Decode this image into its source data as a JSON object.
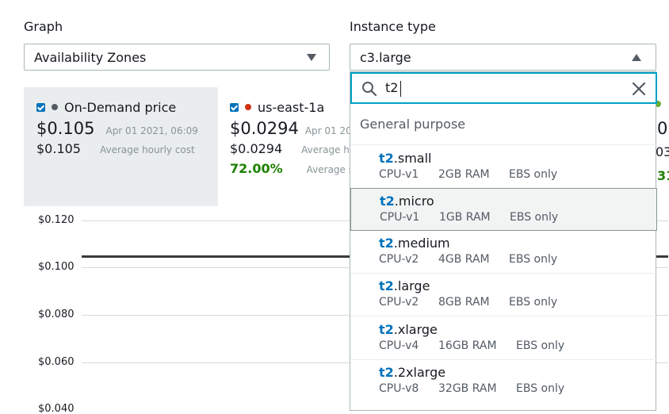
{
  "graph": {
    "label": "Graph",
    "selected": "Availability Zones"
  },
  "instance_type": {
    "label": "Instance type",
    "selected": "c3.large"
  },
  "search": {
    "value": "t2"
  },
  "cards": [
    {
      "name": "On-Demand price",
      "dot_color": "#545b64",
      "price": "$0.105",
      "timestamp": "Apr 01 2021, 06:09",
      "avg_value": "$0.105",
      "avg_label": "Average hourly cost",
      "savings": "",
      "savings_label": ""
    },
    {
      "name": "us-east-1a",
      "dot_color": "#d13212",
      "price": "$0.0294",
      "timestamp": "Apr 01 20",
      "avg_value": "$0.0294",
      "avg_label": "Average ho",
      "savings": "72.00%",
      "savings_label": "Average sa"
    }
  ],
  "card3_partial": {
    "dot_color": "#6aaf35",
    "price": "0",
    "avg": "03",
    "savings": "31"
  },
  "chart": {
    "y_ticks": [
      "$0.120",
      "$0.100",
      "$0.080",
      "$0.060",
      "$0.040"
    ],
    "line_value": "0.105"
  },
  "dropdown": {
    "group": "General purpose",
    "options": [
      {
        "prefix": "t2",
        "suffix": ".small",
        "cpu": "CPU-v1",
        "ram": "2GB RAM",
        "storage": "EBS only",
        "selected": false
      },
      {
        "prefix": "t2",
        "suffix": ".micro",
        "cpu": "CPU-v1",
        "ram": "1GB RAM",
        "storage": "EBS only",
        "selected": true
      },
      {
        "prefix": "t2",
        "suffix": ".medium",
        "cpu": "CPU-v2",
        "ram": "4GB RAM",
        "storage": "EBS only",
        "selected": false
      },
      {
        "prefix": "t2",
        "suffix": ".large",
        "cpu": "CPU-v2",
        "ram": "8GB RAM",
        "storage": "EBS only",
        "selected": false
      },
      {
        "prefix": "t2",
        "suffix": ".xlarge",
        "cpu": "CPU-v4",
        "ram": "16GB RAM",
        "storage": "EBS only",
        "selected": false
      },
      {
        "prefix": "t2",
        "suffix": ".2xlarge",
        "cpu": "CPU-v8",
        "ram": "32GB RAM",
        "storage": "EBS only",
        "selected": false
      }
    ]
  },
  "colors": {
    "accent": "#0073bb",
    "focus": "#00a1c9",
    "success": "#1d8102"
  }
}
